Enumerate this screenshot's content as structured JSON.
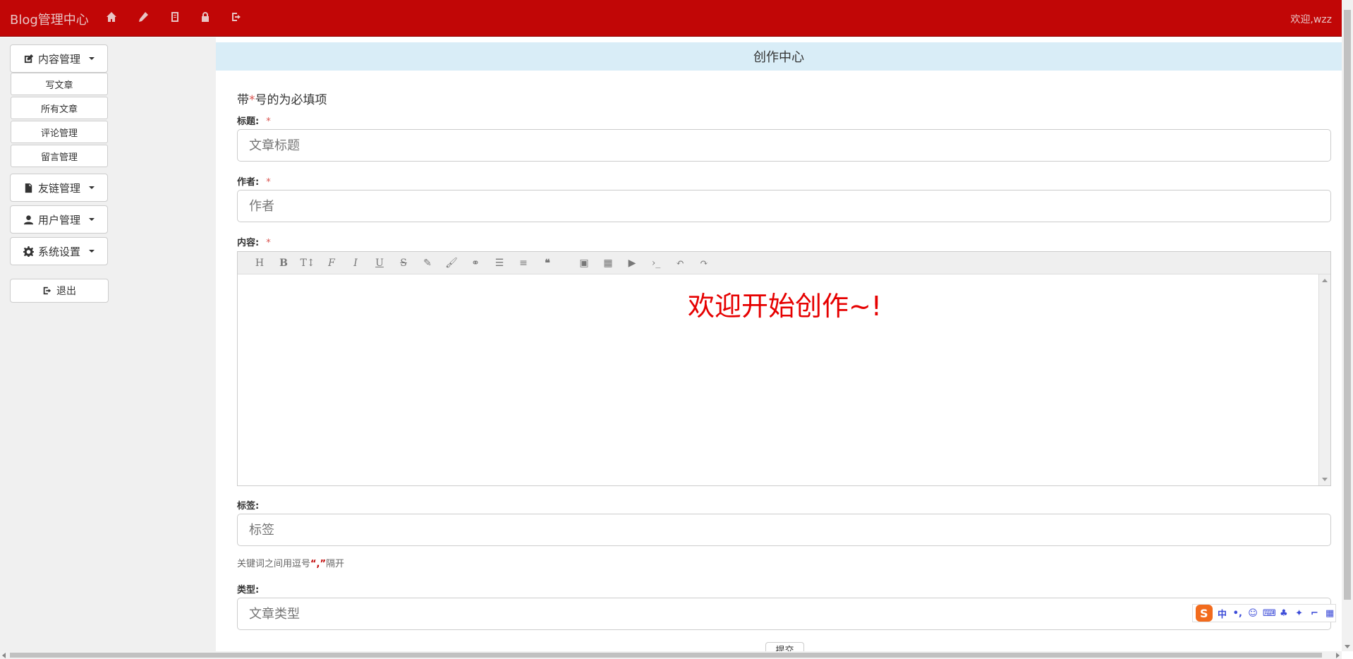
{
  "navbar": {
    "brand": "Blog管理中心",
    "welcome": "欢迎,wzz",
    "icons": [
      "home-icon",
      "pencil-icon",
      "book-icon",
      "lock-icon",
      "logout-icon"
    ]
  },
  "sidebar": {
    "menus": [
      {
        "label": "内容管理",
        "icon": "edit-icon"
      },
      {
        "label": "友链管理",
        "icon": "file-icon"
      },
      {
        "label": "用户管理",
        "icon": "user-icon"
      },
      {
        "label": "系统设置",
        "icon": "gear-icon"
      }
    ],
    "content_submenu": [
      "写文章",
      "所有文章",
      "评论管理",
      "留言管理"
    ],
    "logout_label": "退出"
  },
  "main": {
    "header": "创作中心",
    "required_note": {
      "prefix": "带",
      "star": "*",
      "suffix": "号的为必填项"
    },
    "fields": {
      "title": {
        "label": "标题:",
        "required": "*",
        "placeholder": "文章标题"
      },
      "author": {
        "label": "作者:",
        "required": "*",
        "placeholder": "作者"
      },
      "content": {
        "label": "内容:",
        "required": "*"
      },
      "tags": {
        "label": "标签:",
        "placeholder": "标签"
      },
      "type": {
        "label": "类型:",
        "placeholder": "文章类型"
      }
    },
    "editor_text": "欢迎开始创作~!",
    "tags_hint": {
      "prefix": "关键词之间用逗号",
      "quote": "“,”",
      "suffix": "隔开"
    },
    "submit_label": "提交"
  },
  "editor_toolbar": [
    "H",
    "B",
    "TI",
    "F",
    "I",
    "U",
    "S",
    "eraser",
    "brush",
    "link",
    "ul",
    "align",
    "quote",
    "image",
    "table",
    "video",
    "code",
    "undo",
    "redo"
  ],
  "ime": {
    "logo": "S",
    "items": [
      "中",
      "•,",
      "☺",
      "⌨",
      "♣",
      "✦",
      "⌐",
      "▦"
    ]
  },
  "colors": {
    "navbar": "#c10606",
    "header": "#d9edf7",
    "editor_text": "#e60000"
  }
}
